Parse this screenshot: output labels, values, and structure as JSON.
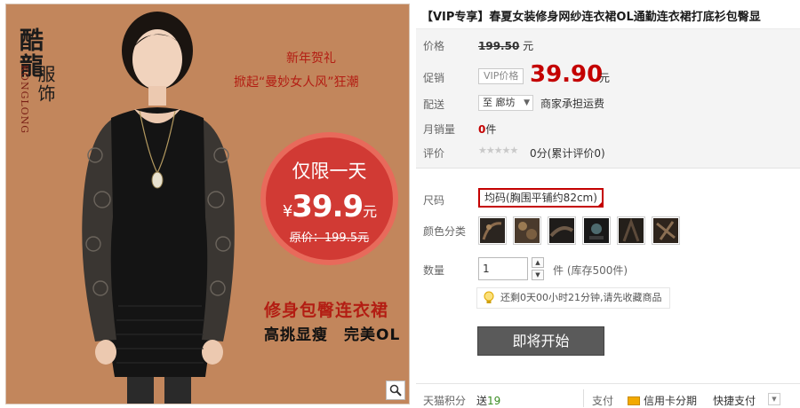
{
  "banner": {
    "brand_cn": "酷龍",
    "brand_en": "KONGLONG",
    "brand_sub": "服饰",
    "promo_line1": "新年贺礼",
    "promo_line2": "掀起“曼妙女人风”狂潮",
    "badge_title": "仅限一天",
    "badge_currency": "¥",
    "badge_price": "39.9",
    "badge_unit": "元",
    "badge_original": "原价：199.5元",
    "slogan1": "修身包臀连衣裙",
    "slogan2": "高挑显瘦　完美OL",
    "zoom_icon": "magnifier-icon"
  },
  "product": {
    "title": "【VIP专享】春夏女装修身网纱连衣裙OL通勤连衣裙打底衫包臀显",
    "price_label": "价格",
    "original_price": "199.50",
    "original_unit": "元",
    "promo_label": "促销",
    "vip_tag": "VIP价格",
    "promo_price": "39.90",
    "promo_unit": "元",
    "shipping_label": "配送",
    "shipping_from": "至 廊坊",
    "shipping_note": "商家承担运费",
    "sales_label": "月销量",
    "sales_count": "0",
    "sales_unit": "件",
    "rating_label": "评价",
    "rating_stars": "★★★★★",
    "rating_text": "0分(累计评价0)"
  },
  "options": {
    "size_label": "尺码",
    "size_selected": "均码(胸围平铺约82cm)",
    "color_label": "颜色分类",
    "color_swatch_count": 6,
    "quantity_label": "数量",
    "quantity_value": "1",
    "quantity_unit": "件 (库存500件)",
    "tip_text": "还剩0天00小时21分钟,请先收藏商品",
    "buy_button": "即将开始"
  },
  "footer": {
    "points_label": "天猫积分",
    "points_text": "送",
    "points_value": "19",
    "pay_label": "支付",
    "card_label": "信用卡分期",
    "quick_label": "快捷支付"
  },
  "colors": {
    "accent_red": "#c40000",
    "banner_bg": "#c2865c",
    "badge_red": "#d13a34",
    "buy_button_bg": "#5a5a5a"
  }
}
